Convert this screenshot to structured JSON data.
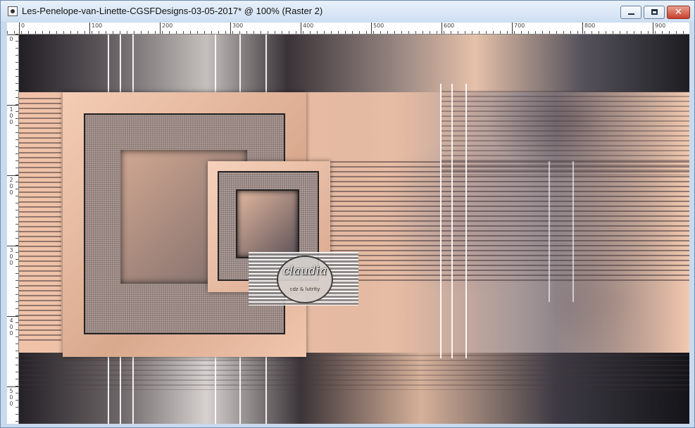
{
  "window": {
    "title": "Les-Penelope-van-Linette-CGSFDesigns-03-05-2017* @ 100% (Raster 2)",
    "controls": {
      "minimize_icon": "minimize-icon",
      "maximize_icon": "maximize-icon",
      "close_icon": "close-icon",
      "close_glyph": "✕"
    }
  },
  "rulers": {
    "horizontal": [
      "0",
      "100",
      "200",
      "300",
      "400",
      "500",
      "600",
      "700",
      "800",
      "900"
    ],
    "vertical": [
      [
        "0"
      ],
      [
        "1",
        "0",
        "0"
      ],
      [
        "2",
        "0",
        "0"
      ],
      [
        "3",
        "0",
        "0"
      ],
      [
        "4",
        "0",
        "0"
      ],
      [
        "5",
        "0",
        "0"
      ]
    ]
  },
  "canvas": {
    "layer": "Raster 2",
    "zoom": "100%",
    "watermark_text": "claudia",
    "watermark_subtext": "cdz & lutrity",
    "colors": {
      "peach": "#f0c3a8",
      "dark": "#242126",
      "gray": "#8d8a94"
    }
  }
}
